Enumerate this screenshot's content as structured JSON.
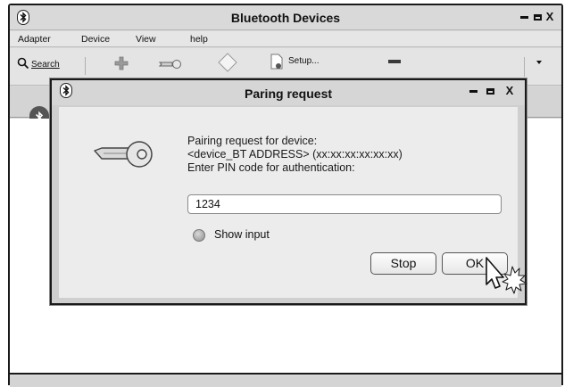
{
  "main_window": {
    "title": "Bluetooth Devices",
    "minimize_label": "–",
    "maximize_label": "□",
    "close_label": "X",
    "menu": [
      "Adapter",
      "Device",
      "View",
      "help"
    ],
    "toolbar": {
      "search_label": "Search",
      "setup_label": "Setup..."
    }
  },
  "dialog": {
    "title": "Paring request",
    "close_label": "X",
    "message_lines": [
      "Pairing request for device:",
      "<device_BT ADDRESS> (xx:xx:xx:xx:xx:xx)",
      "Enter PIN code for authentication:"
    ],
    "pin_value": "1234",
    "show_input_label": "Show input",
    "show_input_checked": false,
    "stop_label": "Stop",
    "ok_label": "OK"
  }
}
